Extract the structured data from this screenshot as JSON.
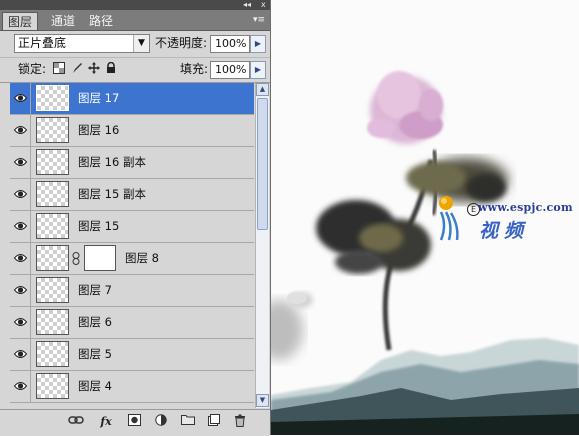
{
  "window": {
    "collapse_glyph": "◂◂",
    "close_glyph": "x"
  },
  "tabs": [
    {
      "label": "图层",
      "active": true
    },
    {
      "label": "通道",
      "active": false
    },
    {
      "label": "路径",
      "active": false
    }
  ],
  "panel_menu_glyph": "▾≡",
  "blend_mode": {
    "value": "正片叠底",
    "arrow": "▼"
  },
  "opacity": {
    "label": "不透明度:",
    "value": "100%",
    "arrow": "▶"
  },
  "lock": {
    "label": "锁定:"
  },
  "fill": {
    "label": "填充:",
    "value": "100%",
    "arrow": "▶"
  },
  "layers": [
    {
      "name": "图层 17",
      "selected": true,
      "has_mask": false
    },
    {
      "name": "图层 16",
      "selected": false,
      "has_mask": false
    },
    {
      "name": "图层 16 副本",
      "selected": false,
      "has_mask": false
    },
    {
      "name": "图层 15 副本",
      "selected": false,
      "has_mask": false
    },
    {
      "name": "图层 15",
      "selected": false,
      "has_mask": false
    },
    {
      "name": "图层 8",
      "selected": false,
      "has_mask": true
    },
    {
      "name": "图层 7",
      "selected": false,
      "has_mask": false
    },
    {
      "name": "图层 6",
      "selected": false,
      "has_mask": false
    },
    {
      "name": "图层 5",
      "selected": false,
      "has_mask": false
    },
    {
      "name": "图层 4",
      "selected": false,
      "has_mask": false
    }
  ],
  "scrollbar": {
    "up": "▲",
    "down": "▼"
  },
  "bottom_tools": {
    "fx": "fx"
  },
  "watermark": {
    "url": "www.espjc.com",
    "mark": "E",
    "cn": "视频"
  },
  "colors": {
    "selection": "#3d74cf",
    "panel_bg": "#d6d6d6",
    "tab_bar": "#7c7c7c"
  }
}
